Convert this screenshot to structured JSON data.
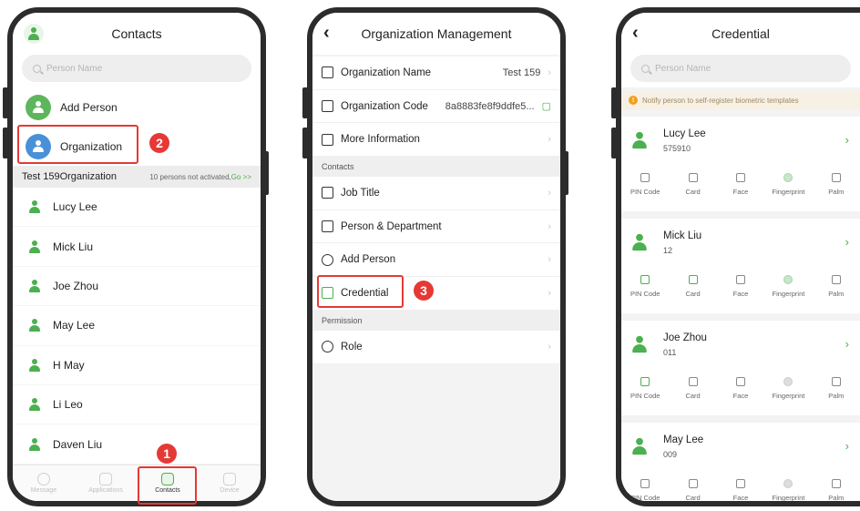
{
  "phone1": {
    "title": "Contacts",
    "search_placeholder": "Person Name",
    "add_person": "Add Person",
    "organization": "Organization",
    "org_name": "Test 159Organization",
    "not_activated": "10 persons not activated,",
    "go": "Go >>",
    "persons": [
      "Lucy Lee",
      "Mick Liu",
      "Joe Zhou",
      "May Lee",
      "H May",
      "Li Leo",
      "Daven Liu"
    ],
    "tabs": [
      "Message",
      "Applications",
      "Contacts",
      "Device"
    ]
  },
  "phone2": {
    "title": "Organization Management",
    "org_name_label": "Organization Name",
    "org_name_value": "Test 159",
    "org_code_label": "Organization Code",
    "org_code_value": "8a8883fe8f9ddfe5...",
    "more_info": "More Information",
    "section_contacts": "Contacts",
    "job_title": "Job Title",
    "person_dept": "Person & Department",
    "add_person": "Add Person",
    "credential": "Credential",
    "section_permission": "Permission",
    "role": "Role"
  },
  "phone3": {
    "title": "Credential",
    "search_placeholder": "Person Name",
    "notify": "Notify person to self-register biometric templates",
    "cred_labels": [
      "PIN Code",
      "Card",
      "Face",
      "Fingerprint",
      "Palm"
    ],
    "people": [
      {
        "name": "Lucy Lee",
        "id": "575910"
      },
      {
        "name": "Mick Liu",
        "id": "12"
      },
      {
        "name": "Joe Zhou",
        "id": "011"
      },
      {
        "name": "May Lee",
        "id": "009"
      }
    ]
  },
  "steps": [
    "1",
    "2",
    "3"
  ],
  "colors": {
    "accent": "#4caf50",
    "highlight": "#e53935"
  }
}
